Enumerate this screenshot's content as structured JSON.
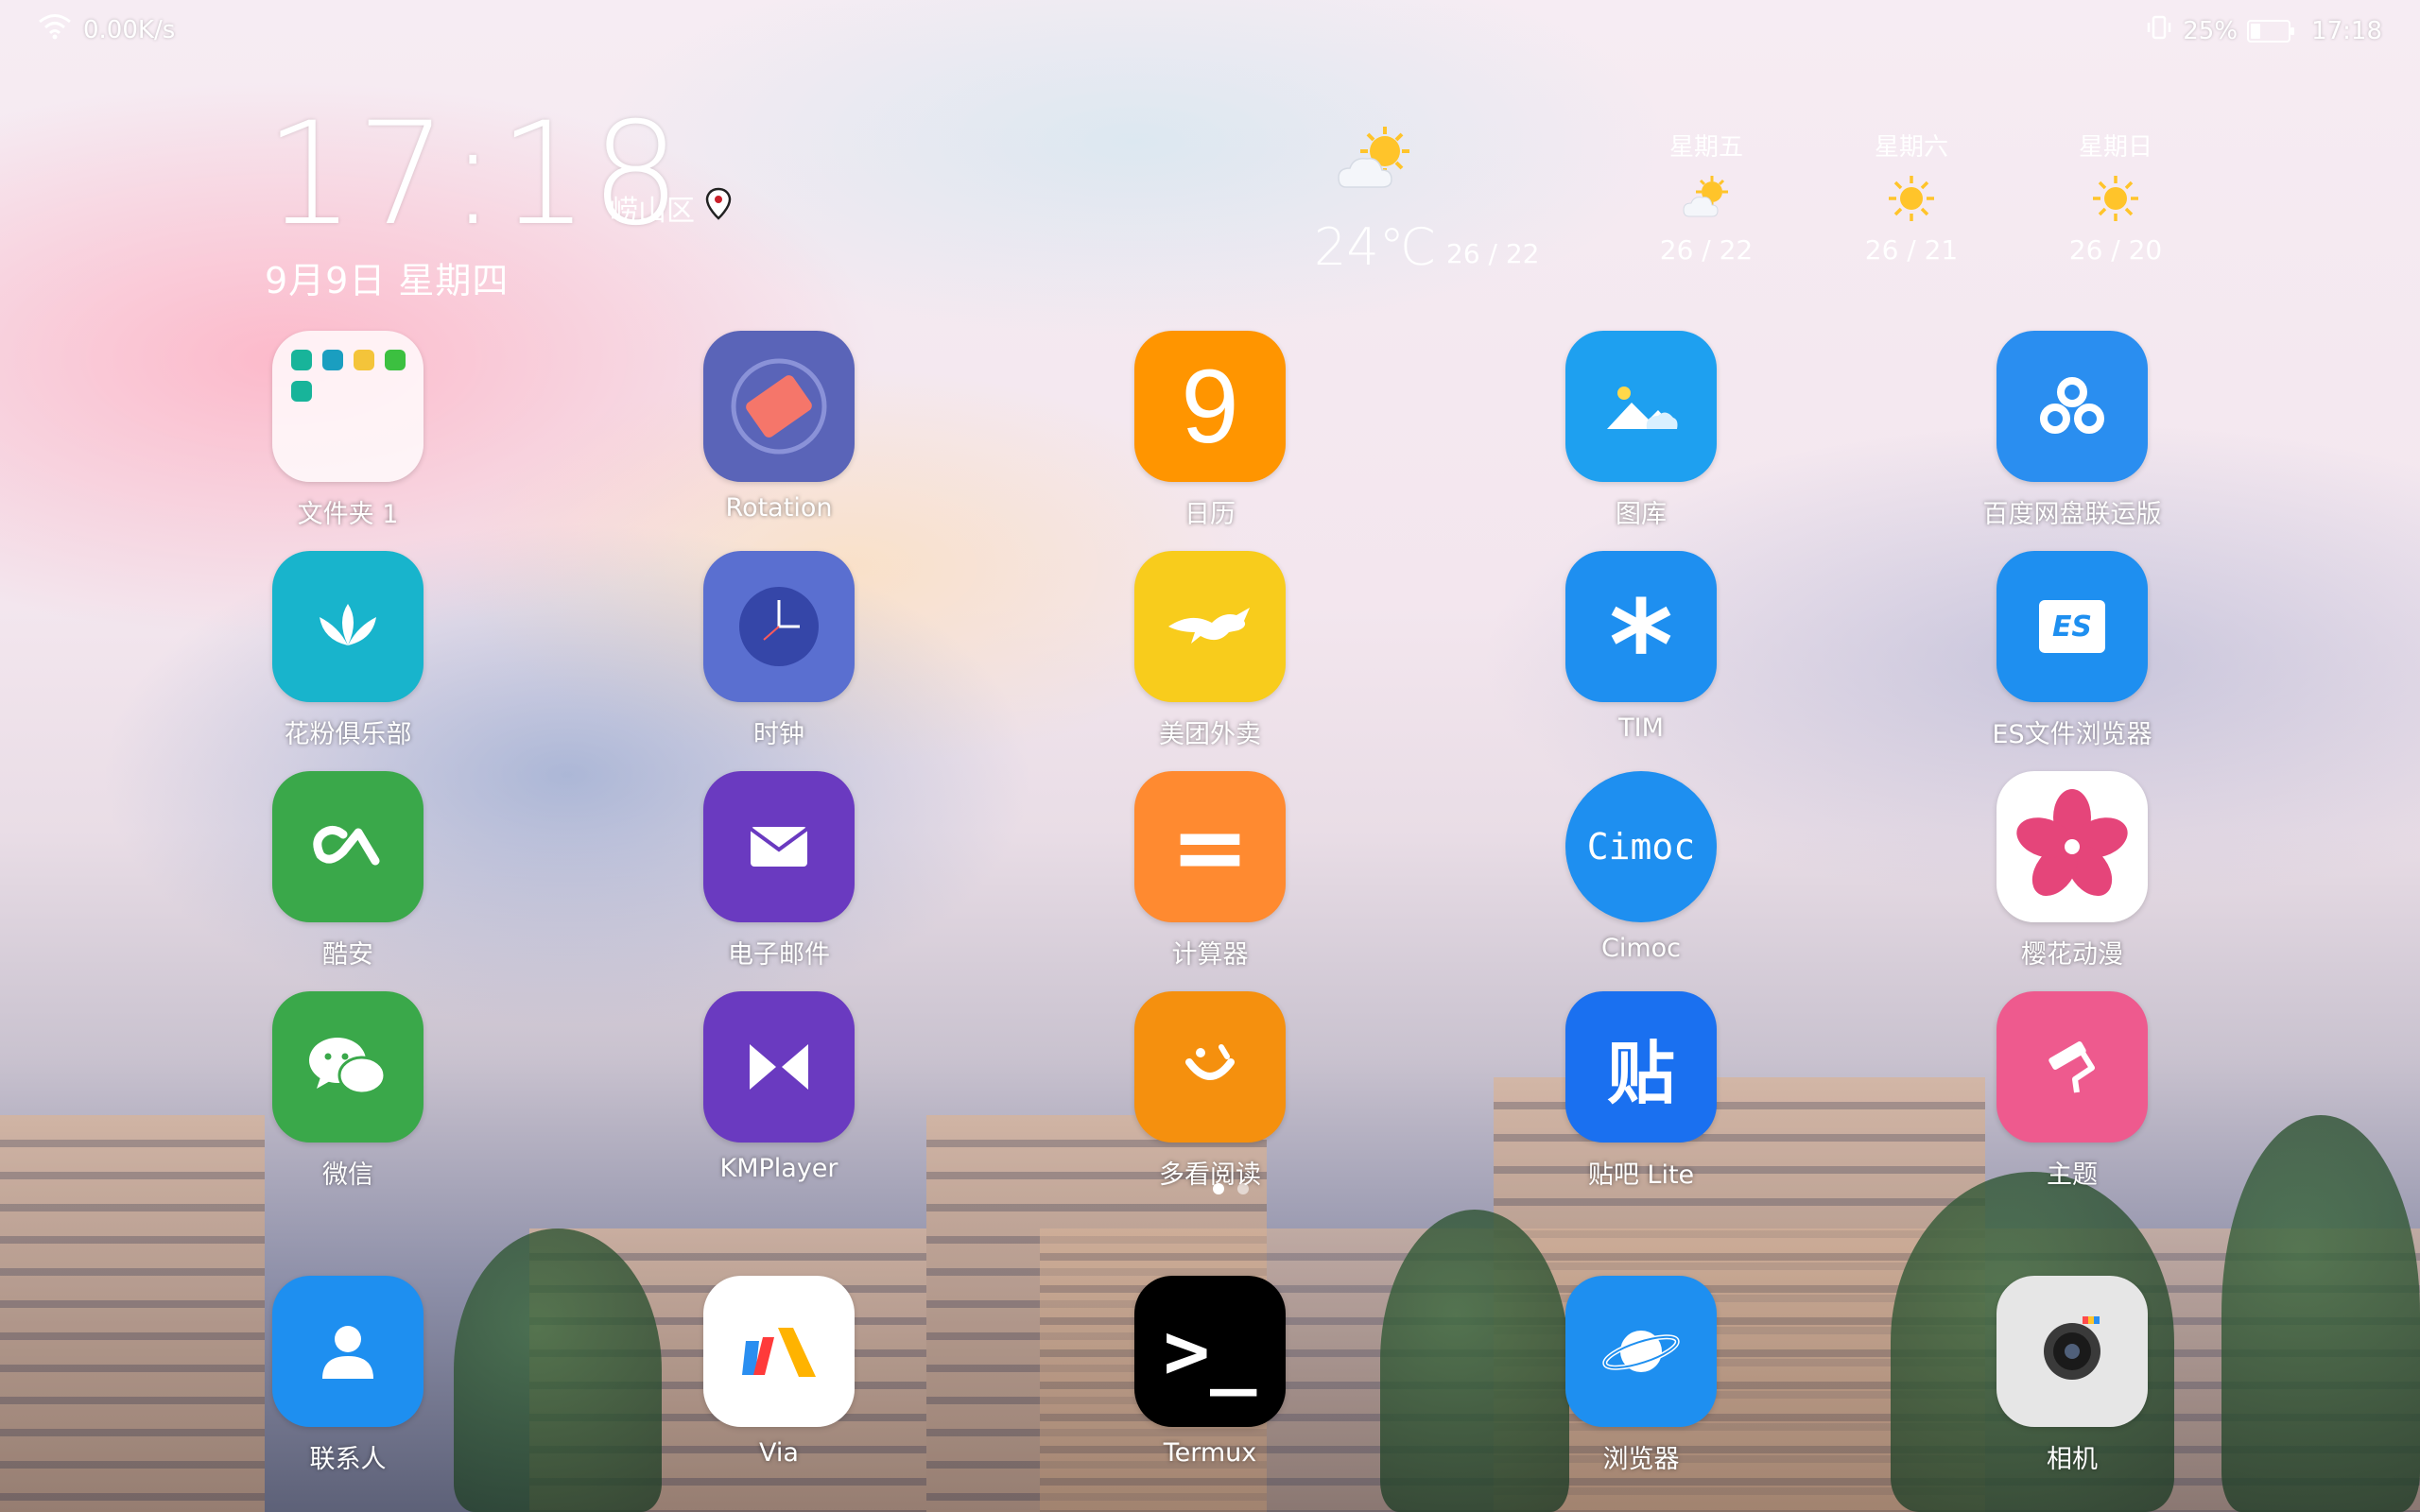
{
  "status": {
    "net_speed": "0.00K/s",
    "battery_percent": "25%",
    "battery_level": 0.25,
    "time": "17:18",
    "icons": [
      "wifi-icon",
      "vibrate-icon",
      "battery-icon"
    ]
  },
  "clock": {
    "time": "17:18",
    "location": "崂山区",
    "date": "9月9日 星期四"
  },
  "weather": {
    "current_temp": "24℃",
    "today_range": "26 / 22",
    "forecast": [
      {
        "day": "星期五",
        "range": "26 / 22",
        "icon": "partly-cloudy-icon"
      },
      {
        "day": "星期六",
        "range": "26 / 21",
        "icon": "sun-icon"
      },
      {
        "day": "星期日",
        "range": "26 / 20",
        "icon": "sun-icon"
      }
    ]
  },
  "apps": [
    {
      "label": "文件夹 1",
      "icon": "folder-icon",
      "color": "#fdf7f9"
    },
    {
      "label": "Rotation",
      "icon": "rotation-icon",
      "color": "#5a64b8"
    },
    {
      "label": "日历",
      "icon": "calendar-icon",
      "glyph": "9",
      "color": "#ff9500"
    },
    {
      "label": "图库",
      "icon": "gallery-icon",
      "color": "#1ea0f0"
    },
    {
      "label": "百度网盘联运版",
      "icon": "baidu-netdisk-icon",
      "color": "#2a8ef0"
    },
    {
      "label": "花粉俱乐部",
      "icon": "lotus-icon",
      "color": "#18b4cc"
    },
    {
      "label": "时钟",
      "icon": "clock-icon",
      "color": "#5a6fd0"
    },
    {
      "label": "美团外卖",
      "icon": "kangaroo-icon",
      "color": "#f8cc1c"
    },
    {
      "label": "TIM",
      "icon": "asterisk-icon",
      "glyph": "*",
      "color": "#1e8ff0"
    },
    {
      "label": "ES文件浏览器",
      "icon": "es-file-icon",
      "glyph": "ES",
      "color": "#1e8ff0"
    },
    {
      "label": "酷安",
      "icon": "coolapk-icon",
      "glyph": "CA",
      "color": "#3aa84a"
    },
    {
      "label": "电子邮件",
      "icon": "mail-icon",
      "color": "#6a3ac0"
    },
    {
      "label": "计算器",
      "icon": "equals-icon",
      "glyph": "=",
      "color": "#ff8a30"
    },
    {
      "label": "Cimoc",
      "icon": "cimoc-icon",
      "glyph": "Cimoc",
      "color": "#1e8ff0"
    },
    {
      "label": "樱花动漫",
      "icon": "sakura-icon",
      "color": "#ffffff"
    },
    {
      "label": "微信",
      "icon": "wechat-icon",
      "color": "#3aa84a"
    },
    {
      "label": "KMPlayer",
      "icon": "kmplayer-icon",
      "color": "#6a3ac0"
    },
    {
      "label": "多看阅读",
      "icon": "smile-icon",
      "color": "#f5900e"
    },
    {
      "label": "贴吧 Lite",
      "icon": "tieba-icon",
      "glyph": "贴",
      "color": "#1a70f0"
    },
    {
      "label": "主题",
      "icon": "paint-roller-icon",
      "color": "#ee5a8e"
    }
  ],
  "dock": [
    {
      "label": "联系人",
      "icon": "contact-icon",
      "color": "#1e8ff0"
    },
    {
      "label": "Via",
      "icon": "via-icon",
      "color": "#ffffff"
    },
    {
      "label": "Termux",
      "icon": "terminal-icon",
      "glyph": ">_",
      "color": "#000000"
    },
    {
      "label": "浏览器",
      "icon": "planet-icon",
      "color": "#1e8ff0"
    },
    {
      "label": "相机",
      "icon": "camera-icon",
      "color": "#e6e6e6"
    }
  ],
  "pages": {
    "count": 2,
    "active": 1
  }
}
